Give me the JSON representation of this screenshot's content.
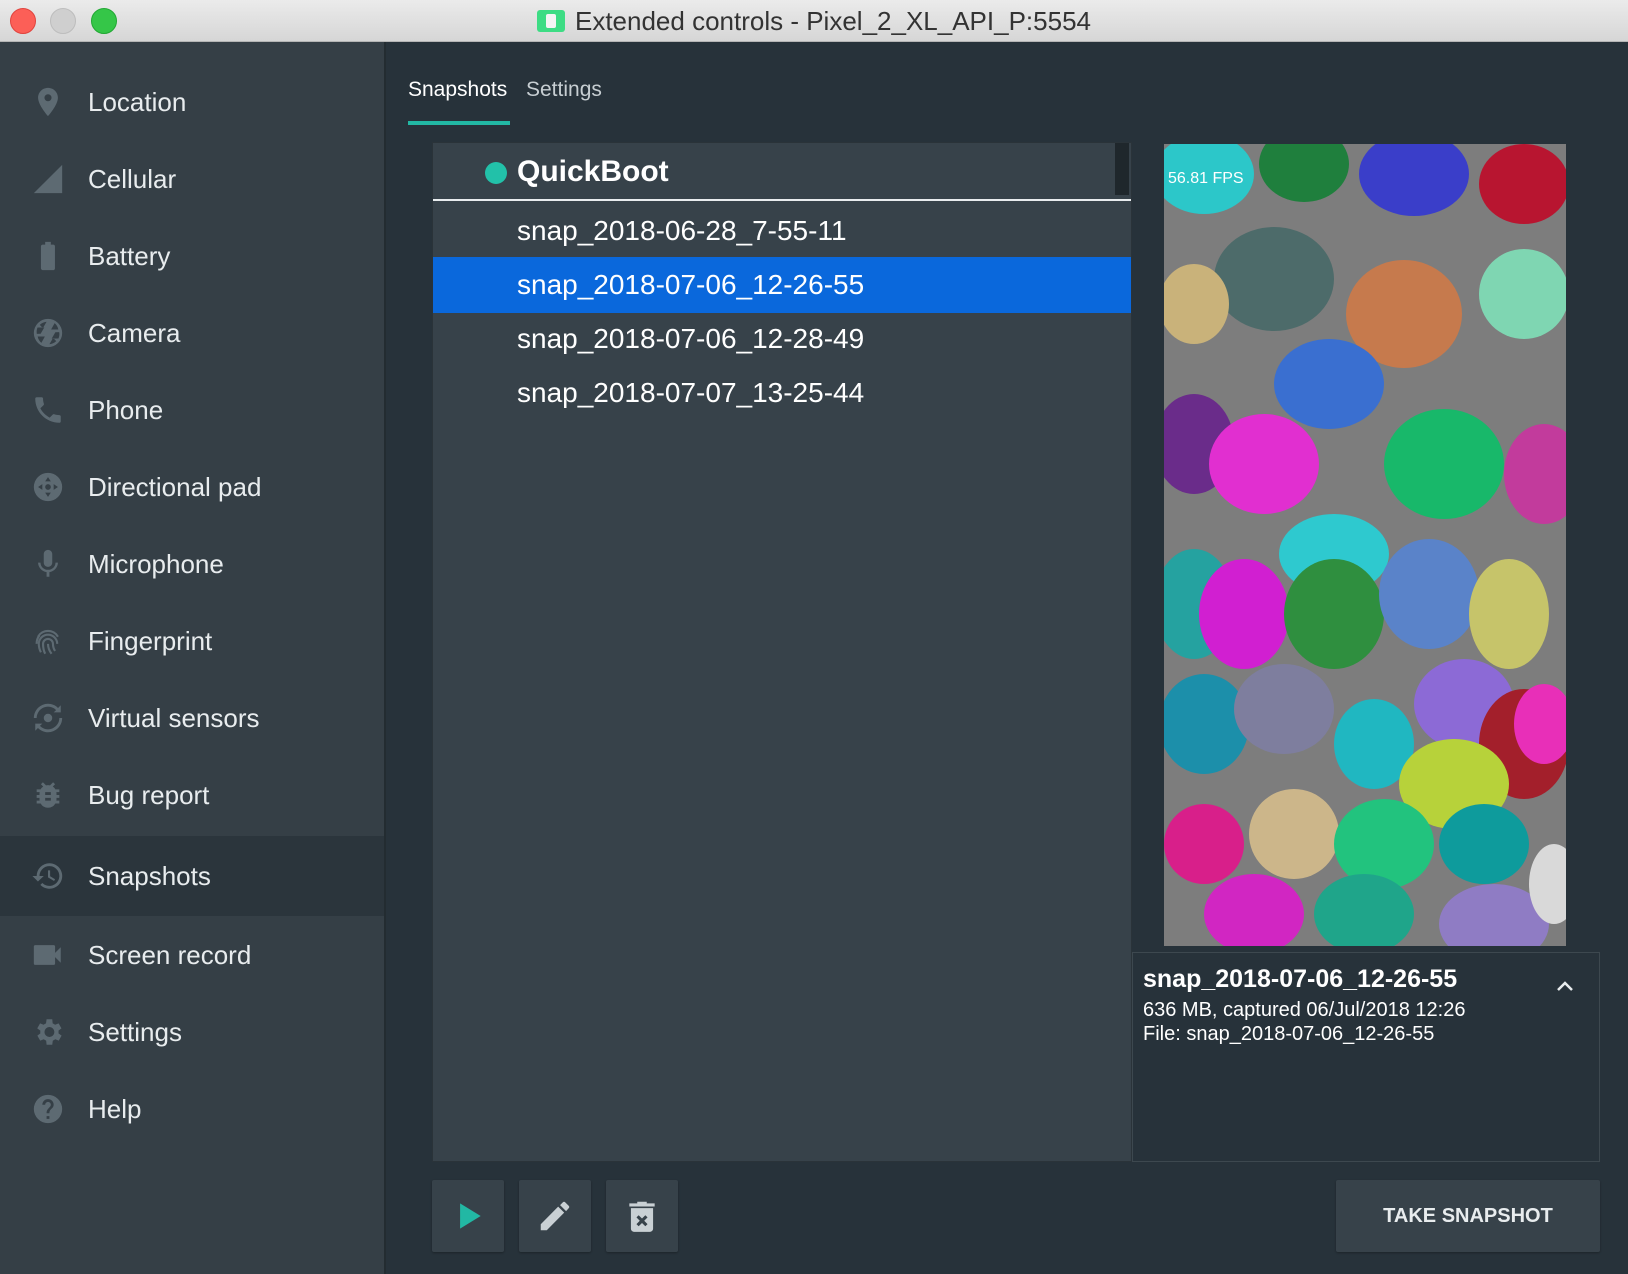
{
  "window": {
    "title": "Extended controls - Pixel_2_XL_API_P:5554"
  },
  "sidebar": {
    "items": [
      {
        "label": "Location",
        "icon": "location-pin-icon"
      },
      {
        "label": "Cellular",
        "icon": "cellular-signal-icon"
      },
      {
        "label": "Battery",
        "icon": "battery-icon"
      },
      {
        "label": "Camera",
        "icon": "camera-aperture-icon"
      },
      {
        "label": "Phone",
        "icon": "phone-icon"
      },
      {
        "label": "Directional pad",
        "icon": "dpad-icon"
      },
      {
        "label": "Microphone",
        "icon": "microphone-icon"
      },
      {
        "label": "Fingerprint",
        "icon": "fingerprint-icon"
      },
      {
        "label": "Virtual sensors",
        "icon": "rotation-sensor-icon"
      },
      {
        "label": "Bug report",
        "icon": "bug-icon"
      },
      {
        "label": "Snapshots",
        "icon": "history-icon",
        "active": true
      },
      {
        "label": "Screen record",
        "icon": "video-camera-icon"
      },
      {
        "label": "Settings",
        "icon": "gear-icon"
      },
      {
        "label": "Help",
        "icon": "help-circle-icon"
      }
    ]
  },
  "tabs": [
    {
      "label": "Snapshots",
      "active": true
    },
    {
      "label": "Settings",
      "active": false
    }
  ],
  "snapshots": {
    "header": "QuickBoot",
    "header_dot_color": "#22c1a9",
    "items": [
      {
        "label": "snap_2018-06-28_7-55-11",
        "selected": false
      },
      {
        "label": "snap_2018-07-06_12-26-55",
        "selected": true
      },
      {
        "label": "snap_2018-07-06_12-28-49",
        "selected": false
      },
      {
        "label": "snap_2018-07-07_13-25-44",
        "selected": false
      }
    ],
    "selection_color": "#0a68dc"
  },
  "preview": {
    "fps": "56.81 FPS"
  },
  "details": {
    "name": "snap_2018-07-06_12-26-55",
    "size_line": "636 MB, captured 06/Jul/2018 12:26",
    "file_line": "File: snap_2018-07-06_12-26-55"
  },
  "toolbar": {
    "play_icon": "play-icon",
    "edit_icon": "pencil-icon",
    "delete_icon": "trash-icon",
    "take_snapshot_label": "TAKE SNAPSHOT",
    "accent": "#22b8a4"
  }
}
